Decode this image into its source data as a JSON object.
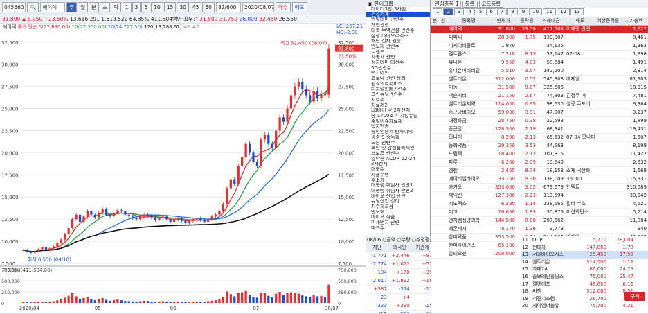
{
  "toolbar": {
    "code": "045660",
    "name": "에이텍",
    "chart_types": [
      "주",
      "월",
      "분",
      "초",
      "틱"
    ],
    "periods": [
      "1",
      "3",
      "5",
      "10",
      "15",
      "30",
      "45",
      "60"
    ],
    "count_label": "82/600",
    "date": "2020/08/07",
    "buy_label": "매수",
    "sell_label": "매도"
  },
  "infobar": {
    "price": "31,800",
    "change": "▲ 6,050",
    "rate": "+23.50%",
    "volume": "13,616,291",
    "amount": "1,613,522",
    "turnover": "64.85%",
    "trade_value": "411,504백만",
    "kind": "최우선",
    "open": "31,800",
    "high": "31,750",
    "low": "26,800",
    "close_label": "32,450",
    "prev": "26,550"
  },
  "chart": {
    "legend_title": "에이텍",
    "legend_items": [
      {
        "label": "종가 단순 5(27,890.00)",
        "color": "#e03030"
      },
      {
        "label": "10(27,300.00)",
        "color": "#2aa040"
      },
      {
        "label": "20(24,727.50)",
        "color": "#2a70e0"
      },
      {
        "label": "120(13,288.67)",
        "color": "#111111"
      },
      {
        "label": "#1",
        "color": "#888888"
      },
      {
        "label": "#2",
        "color": "#888888"
      }
    ],
    "hi_annot": "최고 32,450 (08/07)",
    "lo_annot": "최저 8,550 (04/10)",
    "lc_label": "LC:-267.21",
    "hc_label": "HC:-2.00",
    "price_tag": "31,800",
    "pct_tag": "23.50%",
    "volume_label": "거래대금(411,504.00)",
    "x_labels": [
      "2020/04",
      "05",
      "06",
      "07",
      "08/07"
    ],
    "y_left": [
      "32,500",
      "30,000",
      "27,500",
      "25,000",
      "22,500",
      "20,000",
      "17,500",
      "15,000",
      "12,500",
      "10,000",
      "7,500"
    ],
    "vol_ticks": [
      "750,000",
      "500,000",
      "250,000",
      "0"
    ]
  },
  "chart_data": {
    "type": "candlestick",
    "title": "에이텍",
    "ylim": [
      7500,
      33500
    ],
    "closes": [
      9000,
      8800,
      8700,
      8900,
      9100,
      9300,
      9000,
      9200,
      9400,
      9800,
      10200,
      10800,
      11500,
      12500,
      13000,
      12200,
      12800,
      13400,
      13000,
      12700,
      13200,
      13600,
      13000,
      12800,
      13200,
      13500,
      13400,
      13000,
      12800,
      12600,
      12500,
      12800,
      13000,
      12900,
      12700,
      12400,
      12600,
      12800,
      12500,
      12200,
      12400,
      12600,
      12300,
      12100,
      12300,
      12500,
      12600,
      12400,
      12200,
      12500,
      12800,
      13000,
      13400,
      14200,
      16000,
      17000,
      16500,
      18500,
      19500,
      21000,
      20000,
      19000,
      18500,
      21500,
      22000,
      21000,
      20500,
      22500,
      24000,
      23500,
      25000,
      26500,
      27500,
      28000,
      27200,
      26500,
      25800,
      27000,
      26200,
      26600,
      26550,
      31800
    ],
    "volume_values": [
      20000,
      15000,
      12000,
      18000,
      22000,
      25000,
      14000,
      30000,
      40000,
      60000,
      90000,
      120000,
      160000,
      230000,
      150000,
      90000,
      110000,
      140000,
      80000,
      60000,
      90000,
      110000,
      70000,
      50000,
      65000,
      80000,
      60000,
      45000,
      40000,
      35000,
      30000,
      40000,
      50000,
      45000,
      30000,
      25000,
      35000,
      40000,
      30000,
      25000,
      30000,
      35000,
      25000,
      20000,
      28000,
      33000,
      35000,
      28000,
      22000,
      40000,
      50000,
      60000,
      90000,
      140000,
      260000,
      200000,
      150000,
      230000,
      240000,
      270000,
      180000,
      130000,
      120000,
      230000,
      220000,
      160000,
      130000,
      210000,
      250000,
      180000,
      220000,
      240000,
      220000,
      210000,
      170000,
      150000,
      140000,
      180000,
      150000,
      160000,
      140000,
      411504
    ]
  },
  "themes": {
    "header_label": "한이그룹",
    "items": [
      "데이터3법(5사범",
      "건설기계",
      "반일테마 관련주",
      "개헌관련",
      "대북 무역건설 관련주",
      "삼성 바이오로직스",
      "재난 전자 원정",
      "반도체 관련주",
      "트랜드",
      "자동차 관련",
      "정치테마 대선주",
      "5G관련주",
      "택시테마",
      "코로나 관련 정리",
      "원격의료서비스",
      "디지털화폐관련주",
      "그린뉴딜관련주",
      "치료제1",
      "치료제2",
      "LB바이 및 2차전지",
      "종 1700조 디지털뉴딜",
      "주말이슈자료재",
      "탑지엔종",
      "공인인증서 반사이익",
      "광중 9 중독률",
      "드론 관련주",
      "보안 및 감성룸특체인",
      "브로츠 관련주",
      "알악판 ACDR 22-24",
      "2차전지",
      "대북주",
      "자율주행",
      "수소차",
      "대통령 취임사 관련1",
      "대통령 취임사 관련2",
      "바이오 산업 관련",
      "뉴딜산업 정리",
      "지수체크용",
      "반도체",
      "바이오 식품",
      "미세먼지 관련",
      "마크주"
    ]
  },
  "watch": {
    "group_label": "관심종목 1",
    "reg_label": "등록",
    "code_reg_label": "코드등록",
    "tabs": [
      "1",
      "2",
      "3",
      "4",
      "5",
      "6",
      "7",
      "8",
      "9",
      "10",
      "11",
      "12",
      "13"
    ],
    "col_headers": [
      "분",
      "신",
      "종목명",
      "현재가",
      "등락률",
      "거래대금",
      "매모",
      "예상등락률",
      "시가총액"
    ],
    "rows": [
      {
        "name": "에이텍",
        "price": "31,800",
        "rate": "23.50",
        "amt": "411,504",
        "memo": "이재명 관련",
        "cap": "2,627",
        "sel": true,
        "up": true
      },
      {
        "name": "디피씨",
        "price": "28,300",
        "rate": "1.75",
        "amt": "139,307",
        "memo": "",
        "cap": "8,461",
        "up": true
      },
      {
        "name": "디케이티플로",
        "price": "1,870",
        "rate": "",
        "amt": "34,135",
        "memo": "",
        "cap": "1,363",
        "up": false
      },
      {
        "name": "텔트론스",
        "price": "7,210",
        "rate": "8.15",
        "amt": "53,147",
        "memo": "07-08",
        "cap": "1,898",
        "up": true
      },
      {
        "name": "유니온",
        "price": "9,550",
        "rate": "4.03",
        "amt": "58,684",
        "memo": "",
        "cap": "1,491",
        "up": true
      },
      {
        "name": "유니온머티리얼",
        "price": "5,510",
        "rate": "3.57",
        "amt": "142,200",
        "memo": "",
        "cap": "2,314",
        "up": true
      },
      {
        "name": "셀트리온",
        "price": "312,000",
        "rate": "0.52",
        "amt": "545,308",
        "memo": "바제웰",
        "cap": "81,903",
        "up": true
      },
      {
        "name": "미동",
        "price": "31,500",
        "rate": "9.87",
        "amt": "325,686",
        "memo": "",
        "cap": "18,315",
        "up": true
      },
      {
        "name": "넥슨지티",
        "price": "21,150",
        "rate": "2.67",
        "amt": "74,803",
        "memo": "김정주 매",
        "cap": "7,481",
        "up": true
      },
      {
        "name": "셀트리온제약",
        "price": "114,000",
        "rate": "0.95",
        "amt": "98,630",
        "memo": "셀공 주포비",
        "cap": "9,364",
        "up": true
      },
      {
        "name": "종근당바이오",
        "price": "59,000",
        "rate": "3.91",
        "amt": "47,907",
        "memo": "",
        "cap": "3,237",
        "up": true
      },
      {
        "name": "대정화금",
        "price": "28,750",
        "rate": "0.38",
        "amt": "22,593",
        "memo": "",
        "cap": "1,899",
        "up": true
      },
      {
        "name": "종근당",
        "price": "178,500",
        "rate": "2.19",
        "amt": "68,341",
        "memo": "",
        "cap": "19,431",
        "up": true
      },
      {
        "name": "모나미",
        "price": "8,290",
        "rate": "2.13",
        "amt": "65,532",
        "memo": "07-04 모나미",
        "cap": "1,507",
        "up": true
      },
      {
        "name": "동화약품",
        "price": "29,350",
        "rate": "3.53",
        "amt": "44,563",
        "memo": "",
        "cap": "8,198",
        "up": true
      },
      {
        "name": "드림텍",
        "price": "18,400",
        "rate": "2.13",
        "amt": "101,815",
        "memo": "",
        "cap": "11,422",
        "up": true
      },
      {
        "name": "파루",
        "price": "6,200",
        "rate": "2.99",
        "amt": "10,643",
        "memo": "",
        "cap": "2,632",
        "up": true
      },
      {
        "name": "엠젠",
        "price": "2,455",
        "rate": "8.74",
        "amt": "18,153",
        "memo": "소재 국산화",
        "cap": "1,568",
        "up": true
      },
      {
        "name": "에이비엘바이오",
        "price": "33,150",
        "rate": "9.30",
        "amt": "138,009",
        "memo": "36000",
        "cap": "15,331",
        "up": true
      },
      {
        "name": "카카오",
        "price": "353,000",
        "rate": "3.02",
        "amt": "679,679",
        "memo": "언택트",
        "cap": "310,689",
        "up": true
      },
      {
        "name": "제넥신",
        "price": "127,300",
        "rate": "2.23",
        "amt": "113,594",
        "memo": "",
        "cap": "30,342",
        "up": true
      },
      {
        "name": "시노펙스",
        "price": "6,230",
        "rate": "1.14",
        "amt": "138,665",
        "memo": "필터 수소",
        "cap": "4,521",
        "up": true
      },
      {
        "name": "미코",
        "price": "16,650",
        "rate": "1.83",
        "amt": "30,875",
        "memo": "미산화탄소",
        "cap": "5,214",
        "up": true
      },
      {
        "name": "엔지켐생명과학",
        "price": "144,500",
        "rate": "8.80",
        "amt": "297,662",
        "memo": "",
        "cap": "11,884",
        "up": true
      },
      {
        "name": "레몬제지",
        "price": "8,170",
        "rate": "1.36",
        "amt": "3,773",
        "memo": "",
        "cap": "940",
        "up": true
      },
      {
        "name": "한미약품",
        "price": "353,500",
        "rate": "0.56",
        "amt": "214,186",
        "memo": "바제웰",
        "cap": "41,865",
        "up": true
      },
      {
        "name": "한미사이언스",
        "price": "65,100",
        "rate": "3.20",
        "amt": "23,244",
        "memo": "제약 145000",
        "cap": "42,973",
        "up": true
      },
      {
        "name": "알테오젠",
        "price": "208,000",
        "rate": "2.67",
        "amt": "109,915",
        "memo": "",
        "cap": "27,992",
        "up": true
      }
    ]
  },
  "investors": {
    "date": "08/06",
    "tabs": [
      "금액",
      "수량",
      "추정평균가",
      "순매수",
      "매수",
      "매도",
      "천주",
      "백만"
    ],
    "headers": [
      "개인",
      "외국인",
      "기관계",
      "금융투자",
      "보험",
      "투신",
      "기타"
    ],
    "totals": [
      "-1,771",
      "+2,446",
      "+81",
      "+2",
      "",
      "+81",
      ""
    ],
    "rows": [
      [
        "-2,774",
        "+1,672",
        "+52",
        "",
        "",
        "+109",
        ""
      ],
      [
        "-194",
        "+170",
        "+39",
        "+2",
        "",
        "+18",
        ""
      ],
      [
        "-2,017",
        "+1,892",
        "+18",
        "",
        "",
        "+18",
        ""
      ],
      [
        "+387",
        "-374",
        "-11",
        "",
        "",
        "",
        ""
      ],
      [
        "-23",
        "+4",
        "",
        "",
        "",
        "",
        ""
      ],
      [
        "-323",
        "+390",
        "-15",
        "",
        "",
        "-15",
        ""
      ],
      [
        "-415",
        "-206",
        "+15",
        "",
        "",
        "+15",
        ""
      ],
      [
        "-216",
        "+270",
        "-15",
        "",
        "",
        "-15",
        ""
      ]
    ]
  },
  "lower_list": {
    "rows": [
      {
        "no": "11",
        "name": "OCP",
        "price": "5,770",
        "rate": "28,004"
      },
      {
        "no": "12",
        "name": "현대차",
        "price": "147,000",
        "rate": "1.73"
      },
      {
        "no": "13",
        "name": "서울바이오시스",
        "price": "25,450",
        "rate": "17.55"
      },
      {
        "no": "14",
        "name": "셀트리온",
        "price": "314,500",
        "rate": "1.12"
      },
      {
        "no": "15",
        "name": "카페24",
        "price": "66,000",
        "rate": "24.29"
      },
      {
        "no": "16",
        "name": "솔브레인홀딩스",
        "price": "75,000",
        "rate": "25.47"
      },
      {
        "no": "17",
        "name": "젤엔에프",
        "price": "45,650",
        "rate": "6.16"
      },
      {
        "no": "18",
        "name": "씨젠",
        "price": "312,000",
        "rate": "0.51"
      },
      {
        "no": "19",
        "name": "서진시스템",
        "price": "26,700",
        "rate": "7.89"
      },
      {
        "no": "20",
        "name": "케이엠더블유",
        "price": "75,700",
        "rate": "4.21"
      }
    ],
    "subscribe_label": "구독"
  }
}
